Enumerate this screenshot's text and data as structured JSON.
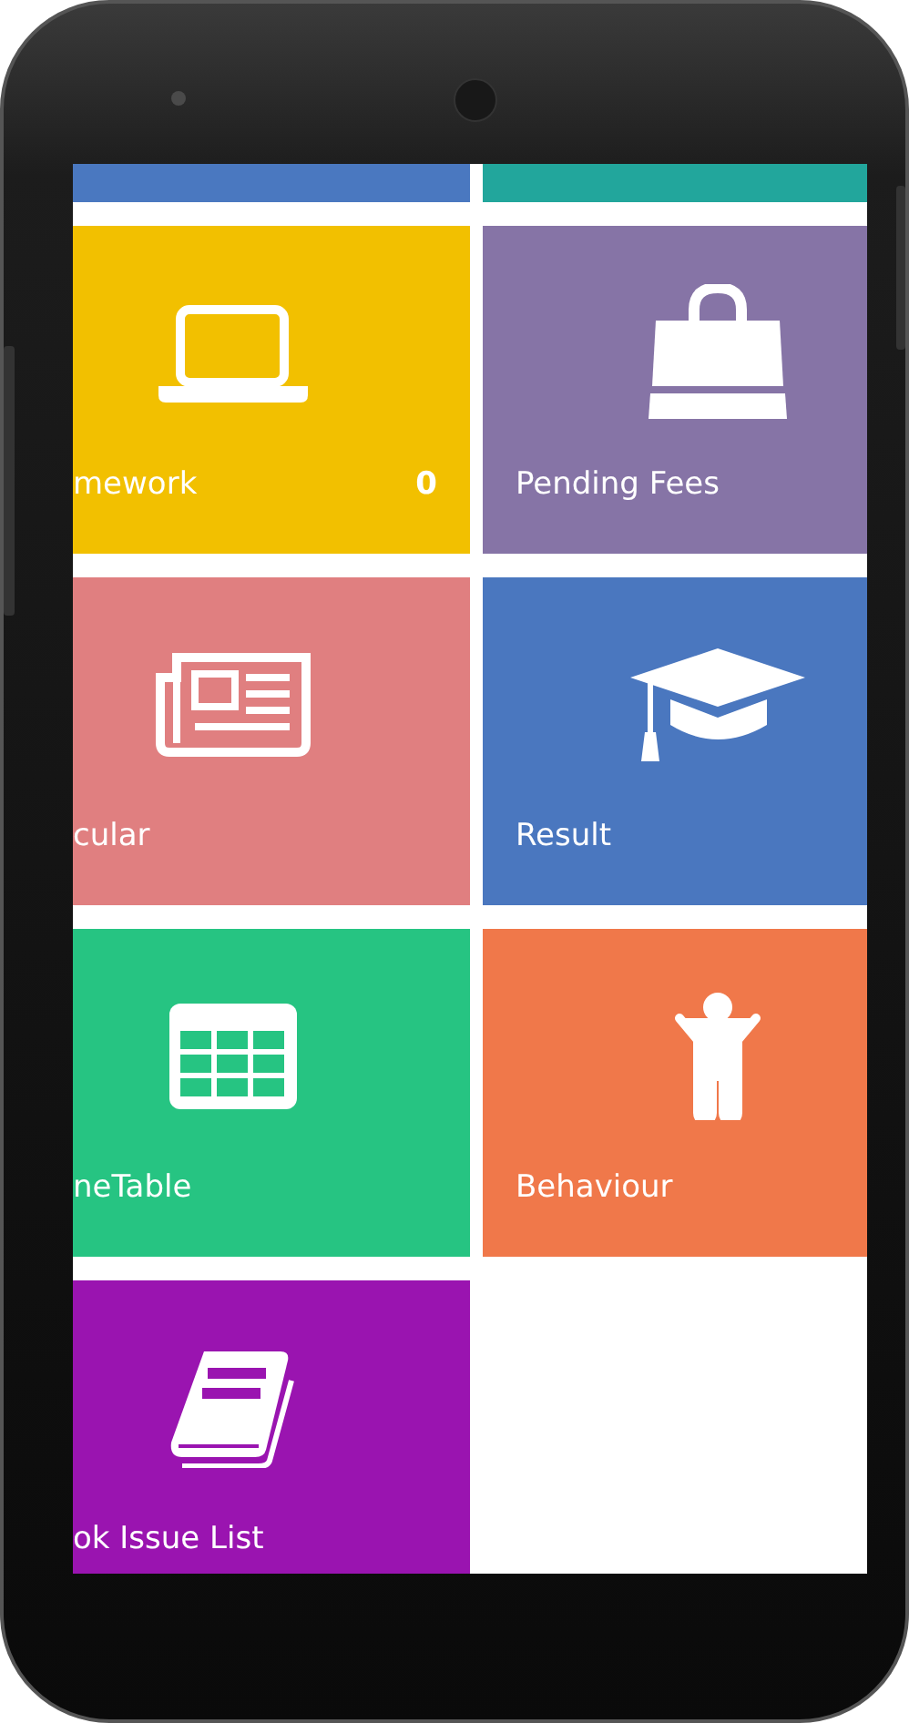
{
  "tiles": [
    {
      "kind": "partial",
      "color": "#4a78c0"
    },
    {
      "kind": "partial",
      "color": "#22a69c"
    },
    {
      "kind": "full",
      "label": "mework",
      "count": "0",
      "color": "#f2c000"
    },
    {
      "kind": "full",
      "label": "Pending Fees",
      "color": "#8674a6"
    },
    {
      "kind": "full",
      "label": "cular",
      "color": "#e07f80"
    },
    {
      "kind": "full",
      "label": "Result",
      "color": "#4a77bf"
    },
    {
      "kind": "full",
      "label": "neTable",
      "color": "#26c482"
    },
    {
      "kind": "full",
      "label": "Behaviour",
      "color": "#f0784a"
    },
    {
      "kind": "full",
      "label": "ok Issue List",
      "color": "#9a14b0"
    }
  ]
}
